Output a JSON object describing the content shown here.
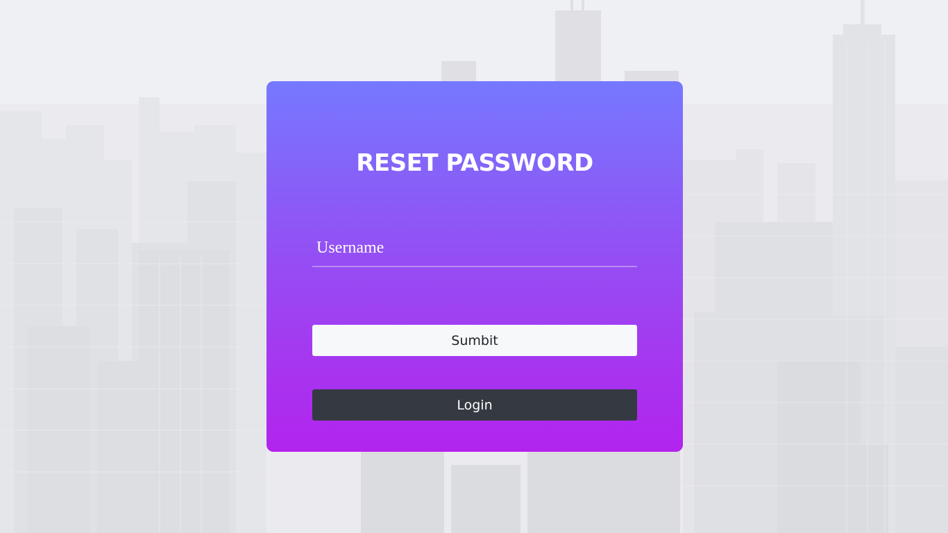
{
  "form": {
    "title": "RESET PASSWORD",
    "username_placeholder": "Username",
    "username_value": "",
    "submit_label": "Sumbit",
    "login_label": "Login"
  },
  "colors": {
    "card_gradient_top": "#7678ff",
    "card_gradient_bottom": "#b224ee",
    "submit_bg": "#f7f8fa",
    "login_bg": "#353941",
    "page_bg": "#e4e6e9"
  },
  "background": {
    "description_icon": "city-skyline"
  }
}
